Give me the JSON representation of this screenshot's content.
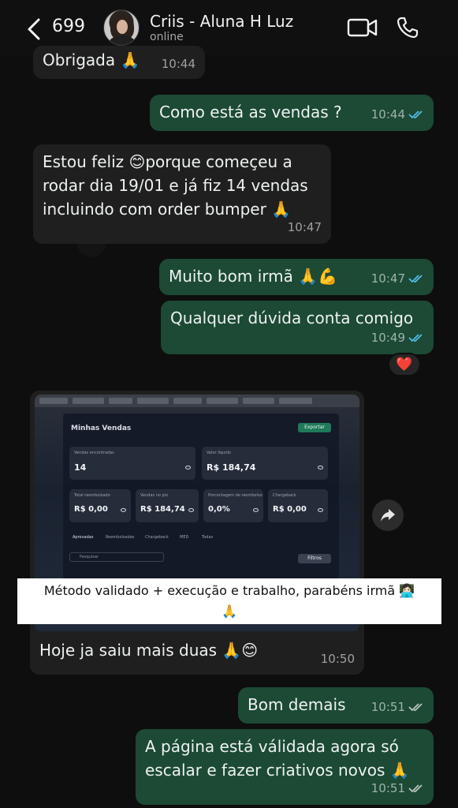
{
  "header": {
    "back_count": "699",
    "contact_name": "Criis - Aluna H Luz",
    "status": "online"
  },
  "messages": [
    {
      "id": "m0",
      "direction": "in",
      "text": "Obrigada 🙏",
      "time": "10:44"
    },
    {
      "id": "m1",
      "direction": "out",
      "text": "Como está as vendas ?",
      "time": "10:44",
      "read": true
    },
    {
      "id": "m2",
      "direction": "in",
      "lines": [
        "Estou feliz 😊porque começeu a",
        "rodar dia 19/01 e já fiz 14 vendas",
        "incluindo com order bumper 🙏"
      ],
      "time": "10:47"
    },
    {
      "id": "m3",
      "direction": "out",
      "text": "Muito bom irmã 🙏💪",
      "time": "10:47",
      "read": true
    },
    {
      "id": "m4",
      "direction": "out",
      "text": "Qualquer dúvida conta comigo",
      "time": "10:49",
      "read": true,
      "reaction": "❤️"
    },
    {
      "id": "m5",
      "direction": "in",
      "type": "image",
      "text": "Hoje ja saiu mais duas 🙏😊",
      "time": "10:50"
    },
    {
      "id": "m6",
      "direction": "out",
      "text": "Bom demais",
      "time": "10:51",
      "read": false
    },
    {
      "id": "m7",
      "direction": "out",
      "lines": [
        "A página está válidada agora só",
        "escalar e fazer criativos novos 🙏"
      ],
      "time": "10:51",
      "read": false
    }
  ],
  "screenshot": {
    "title": "Minhas Vendas",
    "export_label": "Exportar",
    "cards": [
      {
        "label": "Vendas encontradas",
        "value": "14"
      },
      {
        "label": "Valor líquido",
        "value": "R$ 184,74"
      },
      {
        "label": "Total reembolsado",
        "value": "R$ 0,00"
      },
      {
        "label": "Vendas no pix",
        "value": "R$ 184,74"
      },
      {
        "label": "Porcentagem de reembolso",
        "value": "0,0%"
      },
      {
        "label": "Chargeback",
        "value": "R$ 0,00"
      }
    ],
    "tabs": [
      "Aprovadas",
      "Reembolsadas",
      "Chargeback",
      "MED",
      "Todas"
    ],
    "search_placeholder": "Pesquisar",
    "filter_label": "Filtros"
  },
  "caption": {
    "line1": "Método validado + execução e trabalho, parabéns irmã 👩🏻‍💻",
    "line2": "🙏"
  },
  "colors": {
    "incoming_bubble": "#1f1f1f",
    "outgoing_bubble": "#1c4a34",
    "read_ticks": "#53bdeb",
    "unread_ticks": "#9fb3aa"
  }
}
